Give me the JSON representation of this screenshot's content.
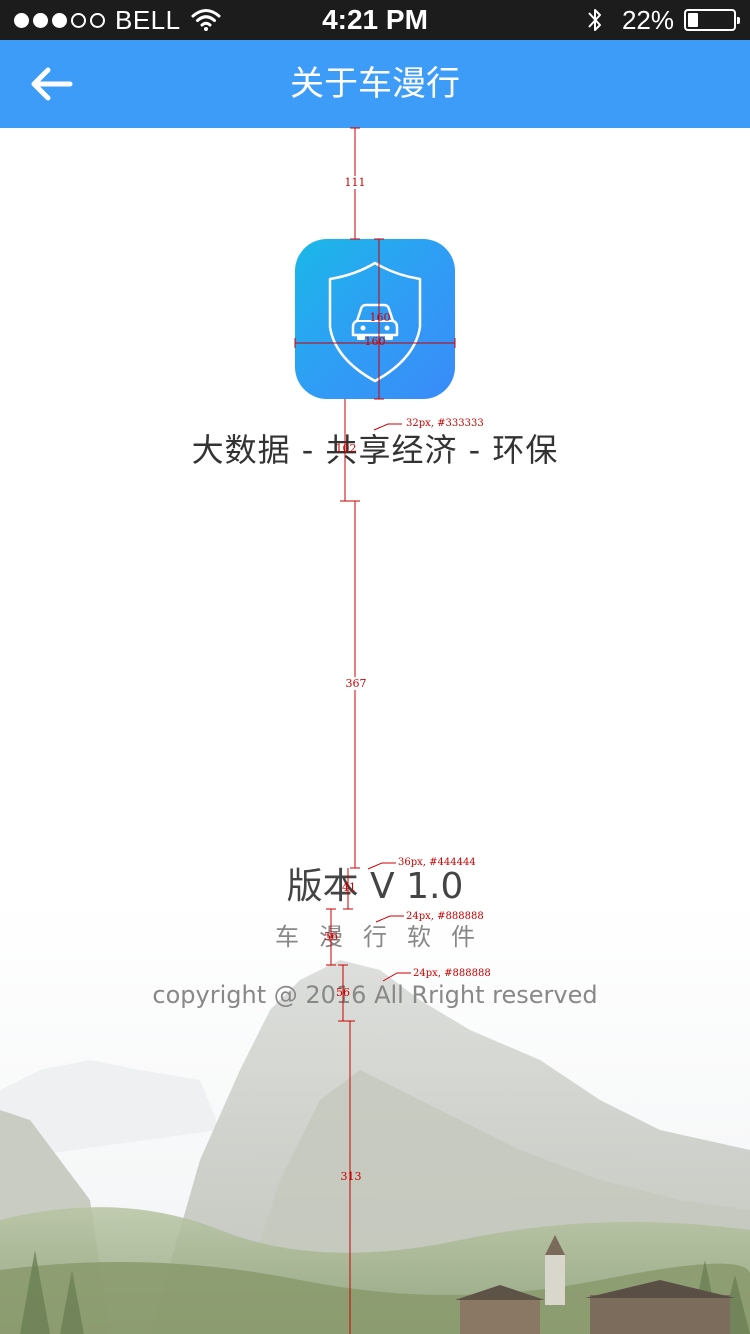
{
  "status_bar": {
    "carrier": "BELL",
    "time": "4:21 PM",
    "battery_percent": "22%",
    "battery_level": 0.22,
    "signal_bars_filled": 3,
    "signal_bars_total": 5
  },
  "nav": {
    "title": "关于车漫行",
    "back_icon": "back-arrow-icon"
  },
  "logo": {
    "icon": "shield-car-icon",
    "colors": {
      "start": "#1ab8e8",
      "end": "#3a8bf8"
    }
  },
  "content": {
    "tagline": "大数据 - 共享经济 - 环保",
    "version": "版本 V 1.0",
    "app_name": "车漫行软件",
    "copyright": "copyright @ 2016 All Rright reserved"
  },
  "annotations": {
    "gap_top": "111",
    "logo_width": "160",
    "logo_height": "160",
    "gap_logo_tagline": "102",
    "gap_tagline_version": "367",
    "gap_version_name": "41",
    "gap_name_copyright": "56",
    "gap_copyright_line": "56",
    "gap_bottom": "313",
    "note_tagline": "32px, #333333",
    "note_version": "36px, #444444",
    "note_app_name": "24px, #888888",
    "note_copyright": "24px, #888888"
  },
  "colors": {
    "nav_background": "#3d9cf7",
    "status_background": "#1c1c1c",
    "tagline_text": "#333333",
    "version_text": "#444444",
    "secondary_text": "#888888"
  }
}
